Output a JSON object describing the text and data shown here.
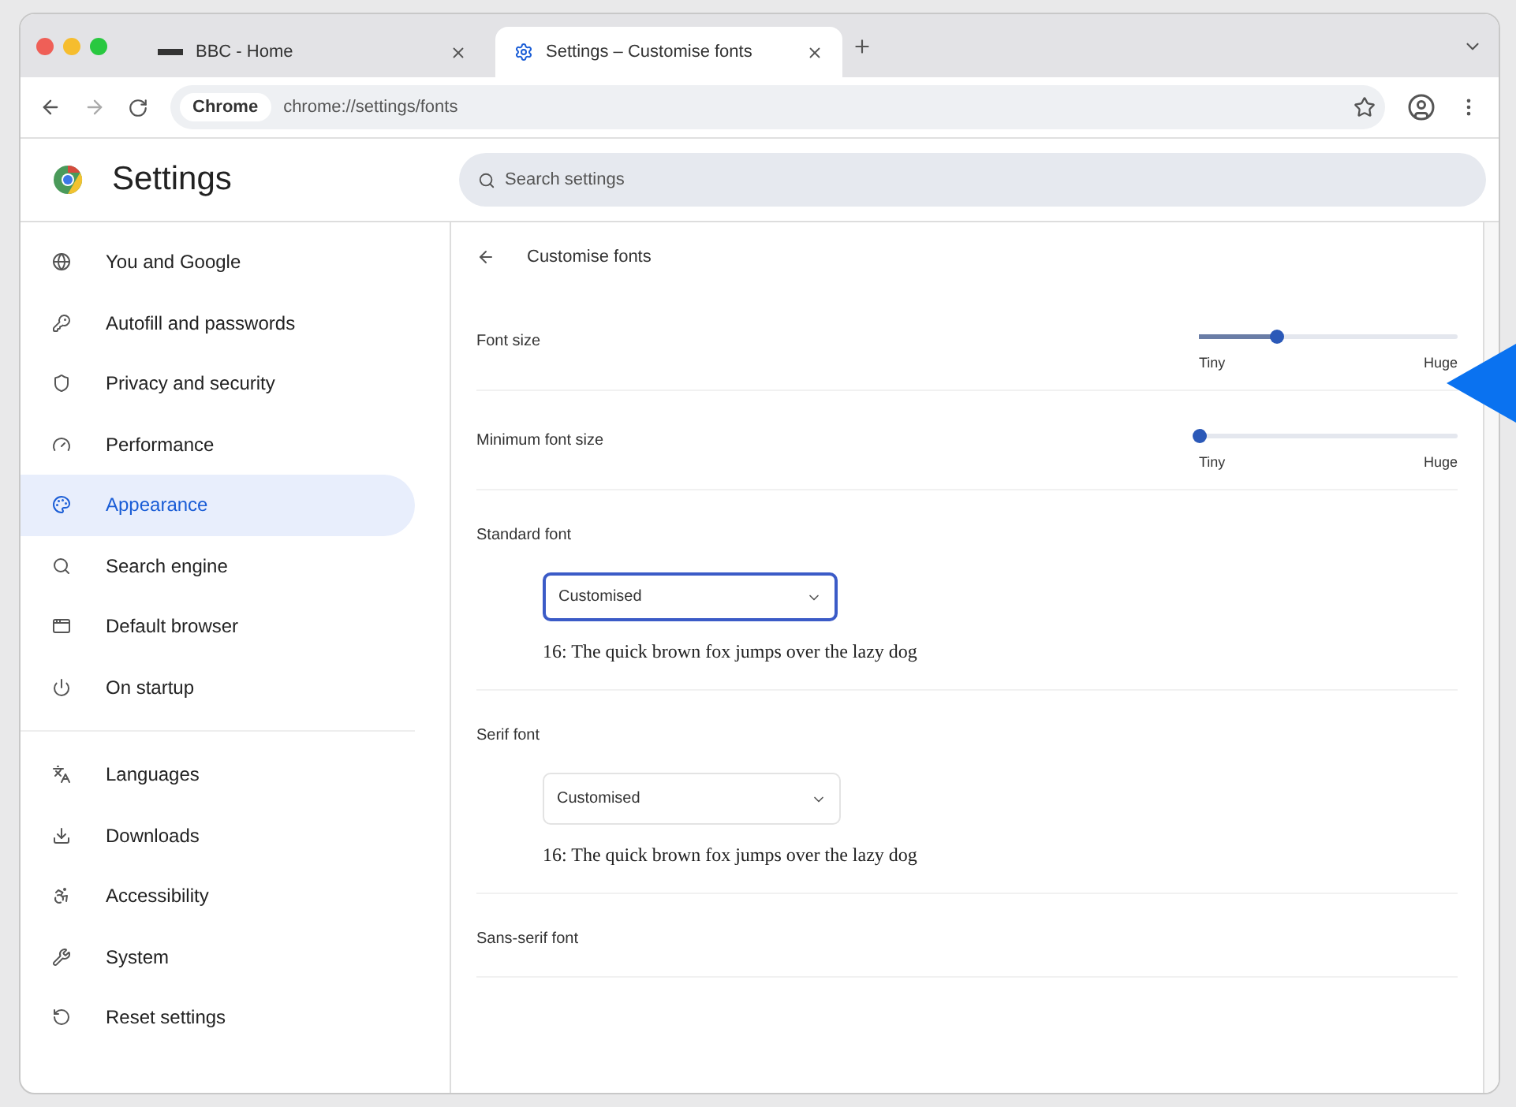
{
  "tabs": [
    {
      "title": "BBC - Home",
      "selected": false
    },
    {
      "title": "Settings – Customise fonts",
      "selected": true
    }
  ],
  "address": {
    "chip": "Chrome",
    "url": "chrome://settings/fonts"
  },
  "header": {
    "title": "Settings",
    "search_placeholder": "Search settings"
  },
  "sidebar": {
    "groups": [
      [
        {
          "label": "You and Google",
          "selected": false
        },
        {
          "label": "Autofill and passwords",
          "selected": false
        },
        {
          "label": "Privacy and security",
          "selected": false
        },
        {
          "label": "Performance",
          "selected": false
        },
        {
          "label": "Appearance",
          "selected": true
        },
        {
          "label": "Search engine",
          "selected": false
        },
        {
          "label": "Default browser",
          "selected": false
        },
        {
          "label": "On startup",
          "selected": false
        }
      ],
      [
        {
          "label": "Languages",
          "selected": false
        },
        {
          "label": "Downloads",
          "selected": false
        },
        {
          "label": "Accessibility",
          "selected": false
        },
        {
          "label": "System",
          "selected": false
        },
        {
          "label": "Reset settings",
          "selected": false
        }
      ]
    ]
  },
  "page": {
    "title": "Customise fonts",
    "sliders": [
      {
        "label": "Font size",
        "level": 0.3,
        "min_label": "Tiny",
        "max_label": "Huge"
      },
      {
        "label": "Minimum font size",
        "level": 0.0,
        "min_label": "Tiny",
        "max_label": "Huge"
      }
    ],
    "fonts": [
      {
        "label": "Standard font",
        "value": "Customised",
        "focused": true,
        "sample": "16: The quick brown fox jumps over the lazy dog"
      },
      {
        "label": "Serif font",
        "value": "Customised",
        "focused": false,
        "sample": "16: The quick brown fox jumps over the lazy dog"
      },
      {
        "label": "Sans-serif font"
      }
    ]
  }
}
